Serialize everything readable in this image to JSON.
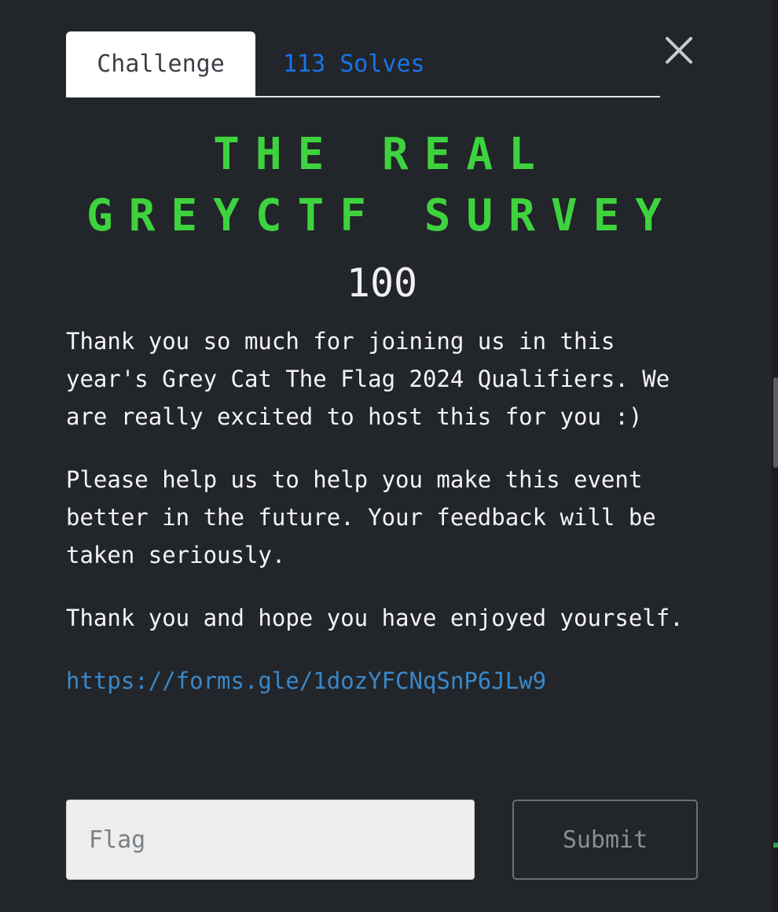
{
  "tabs": {
    "challenge_label": "Challenge",
    "solves_label": "113 Solves"
  },
  "challenge": {
    "title": "THE REAL GREYCTF SURVEY",
    "points": "100",
    "description": [
      "Thank you so much for joining us in this year's Grey Cat The Flag 2024 Qualifiers. We are really excited to host this for you :)",
      "Please help us to help you make this event better in the future. Your feedback will be taken seriously.",
      "Thank you and hope you have enjoyed yourself."
    ],
    "link": "https://forms.gle/1dozYFCNqSnP6JLw9"
  },
  "form": {
    "flag_placeholder": "Flag",
    "flag_value": "",
    "submit_label": "Submit"
  },
  "colors": {
    "background": "#22252a",
    "title": "#3ed33e",
    "tab_link": "#1a74e8",
    "link": "#3a88c8"
  },
  "icons": {
    "close": "close-icon"
  }
}
